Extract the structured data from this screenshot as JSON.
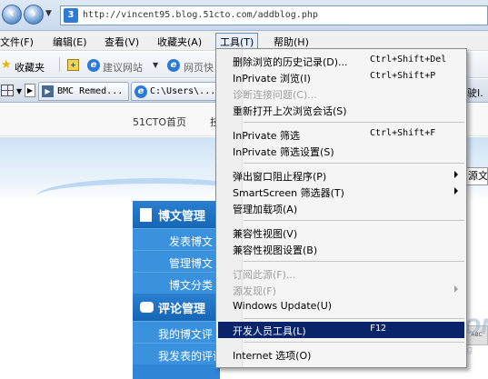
{
  "address_bar": {
    "url": "http://vincent95.blog.51cto.com/addblog.php",
    "site_icon": "3"
  },
  "menu_bar": [
    {
      "label": "文件(F)"
    },
    {
      "label": "编辑(E)"
    },
    {
      "label": "查看(V)"
    },
    {
      "label": "收藏夹(A)"
    },
    {
      "label": "工具(T)",
      "active": true
    },
    {
      "label": "帮助(H)"
    }
  ],
  "favorites_bar": {
    "favorites_label": "收藏夹",
    "suggested_sites_label": "建议网站",
    "web_slice_label": "网页快"
  },
  "tabs": [
    {
      "label": "BMC Remed..."
    },
    {
      "label": "C:\\Users\\..."
    }
  ],
  "tab_right_label": "驶I.",
  "page": {
    "nav_home": "51CTO首页",
    "nav_clip": "技",
    "sidebar": {
      "blog_heading": "博文管理",
      "blog_items": [
        "发表博文",
        "管理博文",
        "博文分类"
      ],
      "comment_heading": "评论管理",
      "comment_items": [
        "我的博文评",
        "我发表的评论"
      ]
    },
    "content_field_fragment": "源文",
    "toolbar_fragment": "ABC"
  },
  "watermark": {
    "top": "51CTO.COM",
    "sub": "技术博客",
    "blog": "Blog"
  },
  "tools_menu": {
    "items": [
      {
        "label": "删除浏览的历史记录(D)...",
        "shortcut": "Ctrl+Shift+Del",
        "disabled": false
      },
      {
        "label": "InPrivate 浏览(I)",
        "shortcut": "Ctrl+Shift+P",
        "disabled": false
      },
      {
        "label": "诊断连接问题(C)...",
        "shortcut": "",
        "disabled": true
      },
      {
        "label": "重新打开上次浏览会话(S)",
        "shortcut": "",
        "disabled": false
      },
      {
        "label": "InPrivate 筛选",
        "shortcut": "Ctrl+Shift+F",
        "disabled": false
      },
      {
        "label": "InPrivate 筛选设置(S)",
        "shortcut": "",
        "disabled": false
      },
      {
        "label": "弹出窗口阻止程序(P)",
        "shortcut": "",
        "disabled": false,
        "submenu": true
      },
      {
        "label": "SmartScreen 筛选器(T)",
        "shortcut": "",
        "disabled": false,
        "submenu": true
      },
      {
        "label": "管理加载项(A)",
        "shortcut": "",
        "disabled": false
      },
      {
        "label": "兼容性视图(V)",
        "shortcut": "",
        "disabled": false
      },
      {
        "label": "兼容性视图设置(B)",
        "shortcut": "",
        "disabled": false
      },
      {
        "label": "订阅此源(F)...",
        "shortcut": "",
        "disabled": true
      },
      {
        "label": "源发现(F)",
        "shortcut": "",
        "disabled": true,
        "submenu": true
      },
      {
        "label": "Windows Update(U)",
        "shortcut": "",
        "disabled": false
      },
      {
        "label": "开发人员工具(L)",
        "shortcut": "F12",
        "disabled": false,
        "highlighted": true
      },
      {
        "label": "Internet 选项(O)",
        "shortcut": "",
        "disabled": false
      }
    ]
  }
}
